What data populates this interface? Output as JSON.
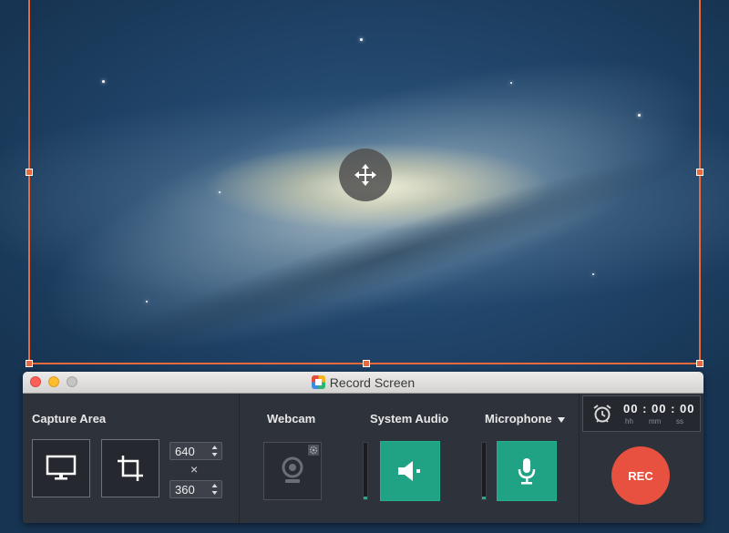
{
  "window": {
    "title": "Record Screen"
  },
  "capture_area": {
    "label": "Capture Area",
    "width": "640",
    "height": "360",
    "times_symbol": "×"
  },
  "webcam": {
    "label": "Webcam"
  },
  "system_audio": {
    "label": "System Audio",
    "level": 0.05
  },
  "microphone": {
    "label": "Microphone",
    "level": 0.05
  },
  "timer": {
    "value": "00 : 00 : 00",
    "units": [
      "hh",
      "mm",
      "ss"
    ]
  },
  "rec_button": {
    "label": "REC"
  },
  "colors": {
    "accent_orange": "#e8693e",
    "green": "#1fa384",
    "rec_red": "#e8503f",
    "panel": "#2e323b"
  },
  "icons": {
    "move": "move-arrows-icon",
    "fullscreen": "monitor-icon",
    "crop": "crop-icon",
    "webcam": "webcam-icon",
    "speaker": "speaker-icon",
    "mic": "microphone-icon",
    "alarm": "alarm-clock-icon"
  }
}
